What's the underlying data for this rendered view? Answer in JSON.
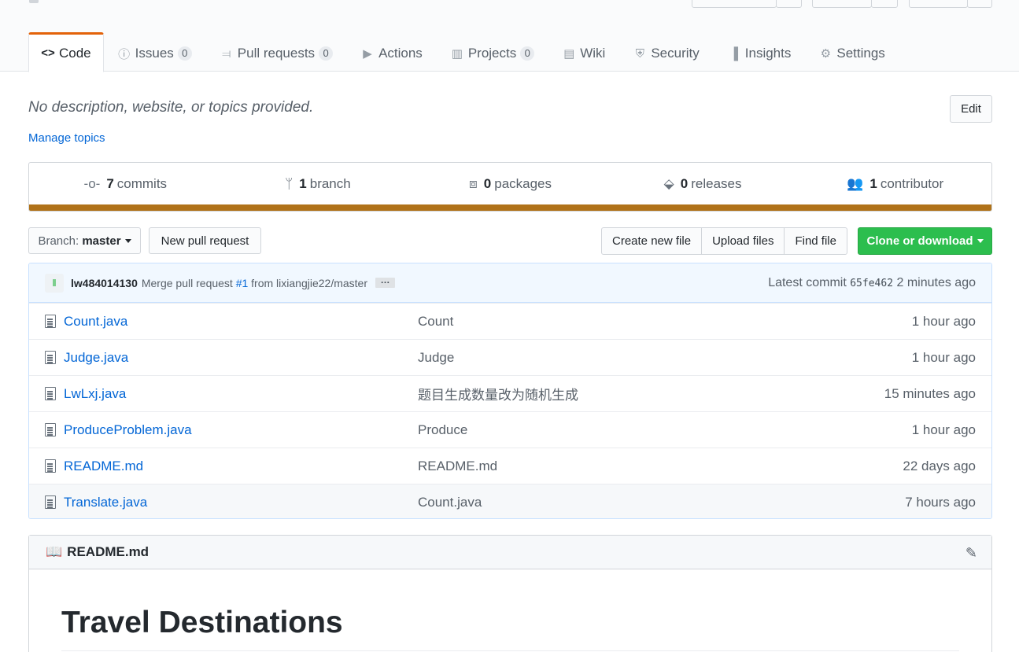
{
  "nav": {
    "tabs": [
      {
        "label": "Code",
        "icon": "code-icon",
        "glyph": "<>",
        "count": null
      },
      {
        "label": "Issues",
        "icon": "issue-icon",
        "glyph": "ⓘ",
        "count": "0"
      },
      {
        "label": "Pull requests",
        "icon": "pull-request-icon",
        "glyph": "⫤",
        "count": "0"
      },
      {
        "label": "Actions",
        "icon": "play-icon",
        "glyph": "▶",
        "count": null
      },
      {
        "label": "Projects",
        "icon": "project-icon",
        "glyph": "▥",
        "count": "0"
      },
      {
        "label": "Wiki",
        "icon": "book-icon",
        "glyph": "▤",
        "count": null
      },
      {
        "label": "Security",
        "icon": "shield-icon",
        "glyph": "⛨",
        "count": null
      },
      {
        "label": "Insights",
        "icon": "graph-icon",
        "glyph": "▐",
        "count": null
      },
      {
        "label": "Settings",
        "icon": "gear-icon",
        "glyph": "⚙",
        "count": null
      }
    ]
  },
  "repo": {
    "description": "No description, website, or topics provided.",
    "manage_topics": "Manage topics",
    "edit_label": "Edit"
  },
  "summary": {
    "commits": {
      "count": "7",
      "label": "commits"
    },
    "branches": {
      "count": "1",
      "label": "branch"
    },
    "packages": {
      "count": "0",
      "label": "packages"
    },
    "releases": {
      "count": "0",
      "label": "releases"
    },
    "contributors": {
      "count": "1",
      "label": "contributor"
    },
    "language_color": "#b07219"
  },
  "toolbar": {
    "branch_prefix": "Branch:",
    "branch_name": "master",
    "new_pull_request": "New pull request",
    "create_new_file": "Create new file",
    "upload_files": "Upload files",
    "find_file": "Find file",
    "clone_or_download": "Clone or download"
  },
  "commit": {
    "author": "lw484014130",
    "message_prefix": "Merge pull request",
    "pr_link": "#1",
    "message_suffix": "from lixiangjie22/master",
    "latest_label": "Latest commit",
    "sha": "65fe462",
    "age": "2 minutes ago"
  },
  "files": [
    {
      "name": "Count.java",
      "message": "Count",
      "age": "1 hour ago"
    },
    {
      "name": "Judge.java",
      "message": "Judge",
      "age": "1 hour ago"
    },
    {
      "name": "LwLxj.java",
      "message": "题目生成数量改为随机生成",
      "age": "15 minutes ago"
    },
    {
      "name": "ProduceProblem.java",
      "message": "Produce",
      "age": "1 hour ago"
    },
    {
      "name": "README.md",
      "message": "README.md",
      "age": "22 days ago"
    },
    {
      "name": "Translate.java",
      "message": "Count.java",
      "age": "7 hours ago"
    }
  ],
  "readme": {
    "filename": "README.md",
    "heading": "Travel Destinations"
  },
  "colors": {
    "accent_tab": "#e36209",
    "link": "#0366d6",
    "clone_button": "#2cbe4e"
  }
}
